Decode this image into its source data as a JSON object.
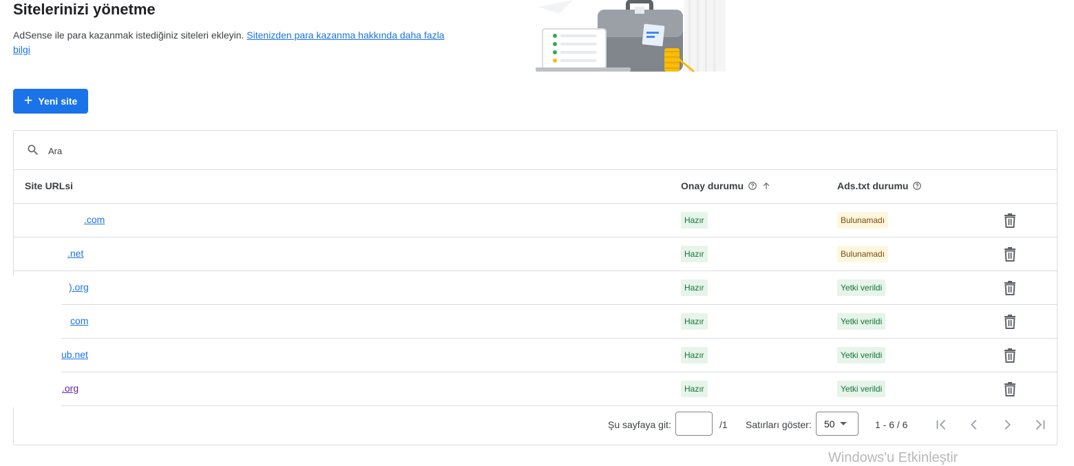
{
  "header": {
    "title": "Sitelerinizi yönetme",
    "description": "AdSense ile para kazanmak istediğiniz siteleri ekleyin. ",
    "learn_more_link": "Sitenizden para kazanma hakkında daha fazla bilgi"
  },
  "new_site_button": {
    "icon": "plus-icon",
    "label": "Yeni site"
  },
  "search": {
    "placeholder": "Ara",
    "icon": "search-icon"
  },
  "table": {
    "columns": {
      "url": "Site URLsi",
      "approval": "Onay durumu",
      "adstxt": "Ads.txt durumu"
    },
    "rows": [
      {
        "url": ".com",
        "approval": "Hazır",
        "adstxt": "Bulunamadı"
      },
      {
        "url": ".net",
        "approval": "Hazır",
        "adstxt": "Bulunamadı"
      },
      {
        "url": ").org",
        "approval": "Hazır",
        "adstxt": "Yetki verildi"
      },
      {
        "url": "com",
        "approval": "Hazır",
        "adstxt": "Yetki verildi"
      },
      {
        "url": "ub.net",
        "approval": "Hazır",
        "adstxt": "Yetki verildi"
      },
      {
        "url": ".org",
        "approval": "Hazır",
        "adstxt": "Yetki verildi"
      }
    ]
  },
  "pagination": {
    "goto_label": "Şu sayfaya git:",
    "page_input_value": "",
    "total_pages": "/1",
    "rows_label": "Satırları göster:",
    "rows_value": "50",
    "range": "1 - 6 / 6"
  },
  "colors": {
    "primary": "#1a73e8",
    "ready_bg": "#e6f4ea",
    "ready_text": "#137333",
    "warn_bg": "#fef7e0",
    "warn_text": "#7a4b00",
    "visited_link": "#681da8"
  },
  "watermark": "Windows'u Etkinleştir"
}
